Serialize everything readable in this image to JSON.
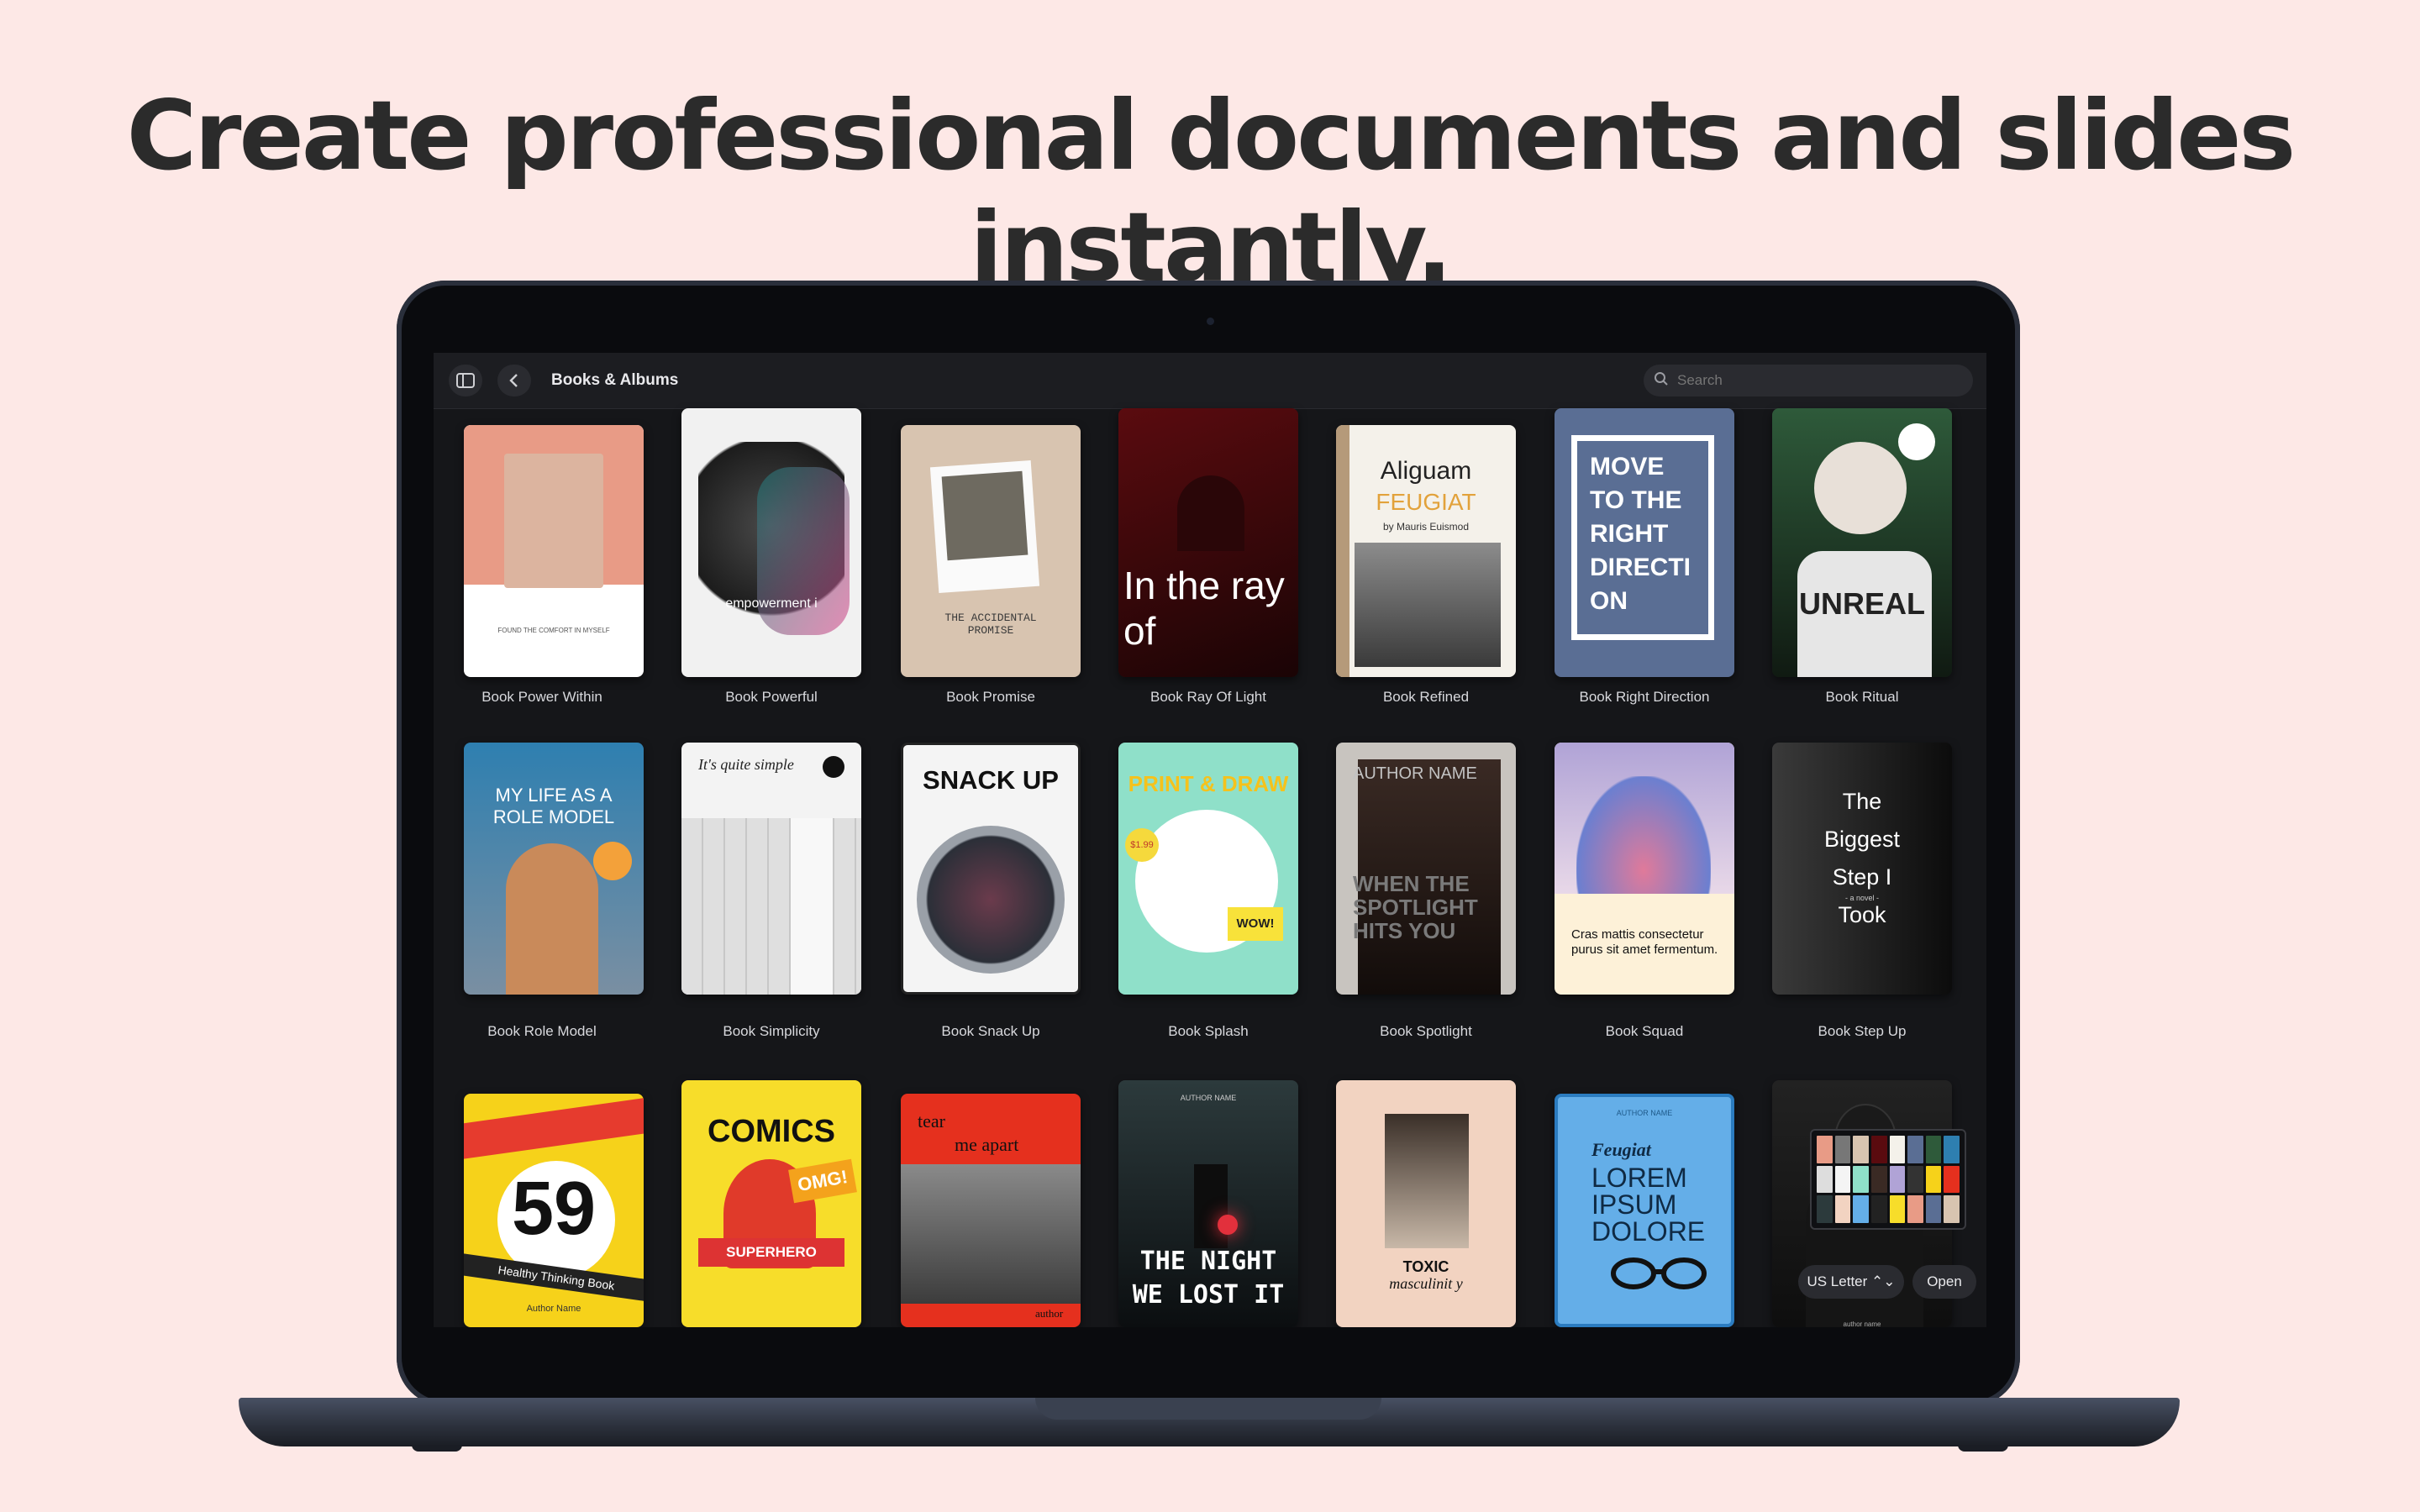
{
  "headline": "Create professional documents and slides instantly.",
  "toolbar": {
    "title": "Books & Albums",
    "search_placeholder": "Search"
  },
  "books": [
    {
      "name": "Book Power Within",
      "text": "FOUND THE COMFORT IN MYSELF"
    },
    {
      "name": "Book Powerful",
      "text": "empowerment i"
    },
    {
      "name": "Book Promise",
      "text": "THE ACCIDENTAL PROMISE"
    },
    {
      "name": "Book Ray Of Light",
      "text": "In the ray of"
    },
    {
      "name": "Book Refined",
      "text": "Aliguam",
      "text2": "FEUGIAT",
      "text3": "by Mauris Euismod"
    },
    {
      "name": "Book Right Direction",
      "text": "MOVE TO THE RIGHT DIRECTI ON"
    },
    {
      "name": "Book Ritual",
      "text": "UNREAL"
    },
    {
      "name": "Book Role Model",
      "text": "MY LIFE AS A ROLE MODEL"
    },
    {
      "name": "Book Simplicity",
      "text": "It's quite simple"
    },
    {
      "name": "Book Snack Up",
      "text": "SNACK UP"
    },
    {
      "name": "Book Splash",
      "text": "PRINT & DRAW",
      "text2": "WOW!",
      "text3": "$1.99"
    },
    {
      "name": "Book Spotlight",
      "text": "AUTHOR NAME",
      "text2": "WHEN THE SPOTLIGHT HITS YOU"
    },
    {
      "name": "Book Squad",
      "text": "Cras mattis consectetur purus sit amet fermentum."
    },
    {
      "name": "Book Step Up",
      "text": "The Biggest Step I Took",
      "text2": "- a novel -"
    },
    {
      "name": "",
      "text": "59",
      "text2": "Healthy Thinking Book",
      "text3": "Author Name"
    },
    {
      "name": "",
      "text": "COMICS",
      "text2": "SUPERHERO",
      "text3": "OMG!"
    },
    {
      "name": "",
      "text": "tear",
      "text2": "me apart",
      "text3": "author"
    },
    {
      "name": "",
      "text": "THE NIGHT WE LOST IT",
      "text2": "AUTHOR NAME"
    },
    {
      "name": "",
      "text": "TOXIC",
      "text2": "masculinit y"
    },
    {
      "name": "",
      "text": "Feugiat",
      "text2": "LOREM IPSUM DOLORE",
      "text3": "AUTHOR NAME"
    },
    {
      "name": "",
      "text": "author name"
    }
  ],
  "controls": {
    "page_size": "US Letter",
    "open_label": "Open"
  },
  "colors": {
    "background": "#fde8e6",
    "screen": "#151619",
    "accent_yellow": "#f5d20b"
  }
}
